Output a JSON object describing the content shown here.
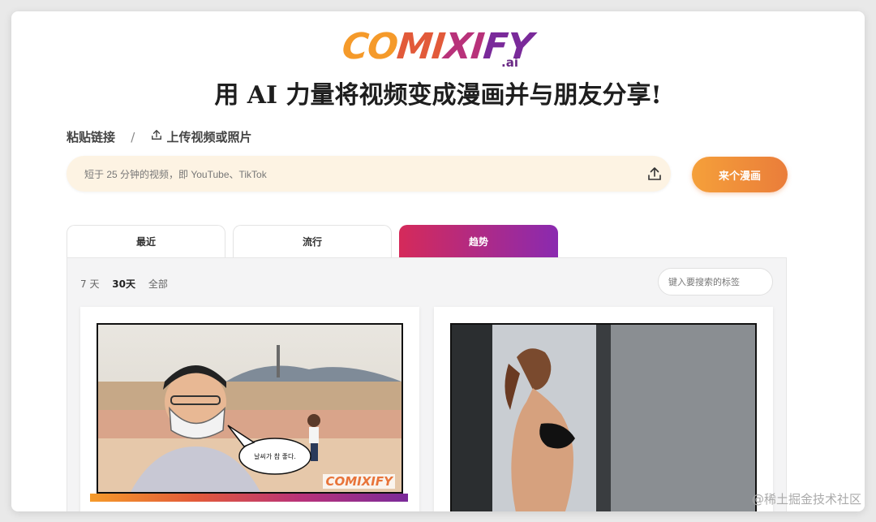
{
  "logo": {
    "text": "COMIXIFY",
    "suffix": ".ai"
  },
  "headline": "用 AI 力量将视频变成漫画并与朋友分享!",
  "source": {
    "paste_label": "粘贴链接",
    "separator": "/",
    "upload_label": "上传视频或照片"
  },
  "url_input": {
    "placeholder": "短于 25 分钟的视频，即 YouTube、TikTok",
    "value": ""
  },
  "go_button": "来个漫画",
  "tabs": [
    {
      "label": "最近",
      "active": false
    },
    {
      "label": "流行",
      "active": false
    },
    {
      "label": "趋势",
      "active": true
    }
  ],
  "time_filters": [
    {
      "label": "7 天",
      "selected": false
    },
    {
      "label": "30天",
      "selected": true
    },
    {
      "label": "全部",
      "selected": false
    }
  ],
  "tag_search": {
    "placeholder": "键入要搜索的标签",
    "value": ""
  },
  "cards": [
    {
      "speech_bubble": "날씨가 참 좋다.",
      "watermark": "COMIXIFY"
    },
    {
      "speech_bubble": "",
      "watermark": ""
    }
  ],
  "page_watermark": "@稀土掘金技术社区",
  "colors": {
    "accent_orange": "#ea7d3a",
    "tab_gradient_start": "#d52a5a",
    "tab_gradient_end": "#8a2ab0",
    "input_bg": "#fdf3e3"
  },
  "icons": [
    "upload-icon"
  ]
}
